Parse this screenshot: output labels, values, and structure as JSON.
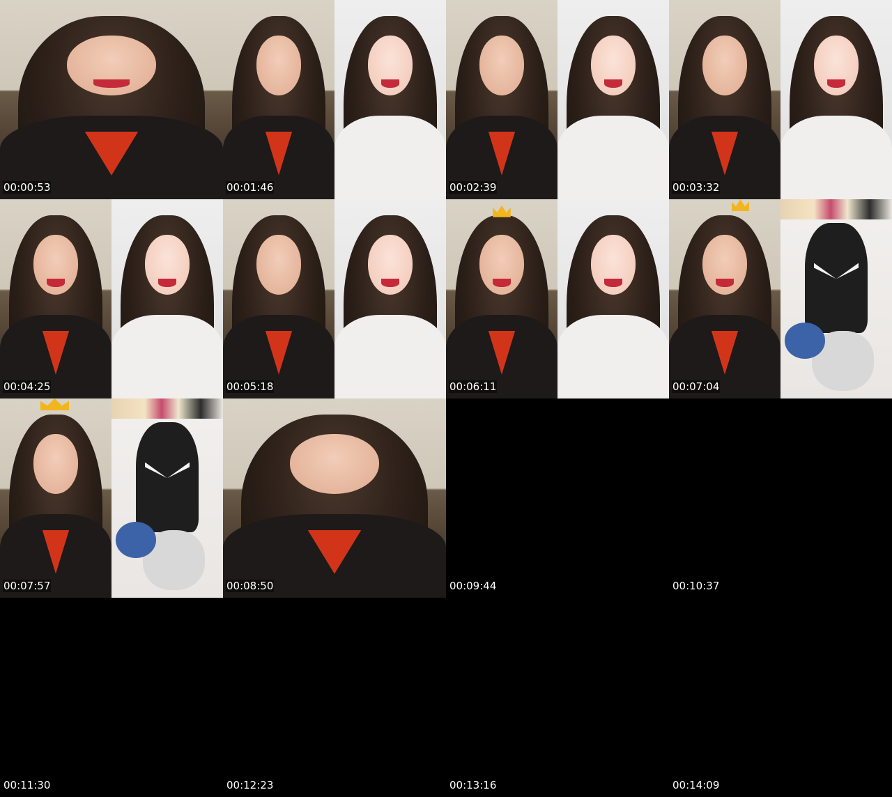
{
  "timestamps": [
    "00:00:53",
    "00:01:46",
    "00:02:39",
    "00:03:32",
    "00:04:25",
    "00:05:18",
    "00:06:11",
    "00:07:04",
    "00:07:57",
    "00:08:50",
    "00:09:44",
    "00:10:37",
    "00:11:30",
    "00:12:23",
    "00:13:16",
    "00:14:09"
  ],
  "colors": {
    "background": "#000000",
    "timestamp_text": "#ffffff",
    "shirt": "#d2341a",
    "crown": "#f2b51e"
  }
}
